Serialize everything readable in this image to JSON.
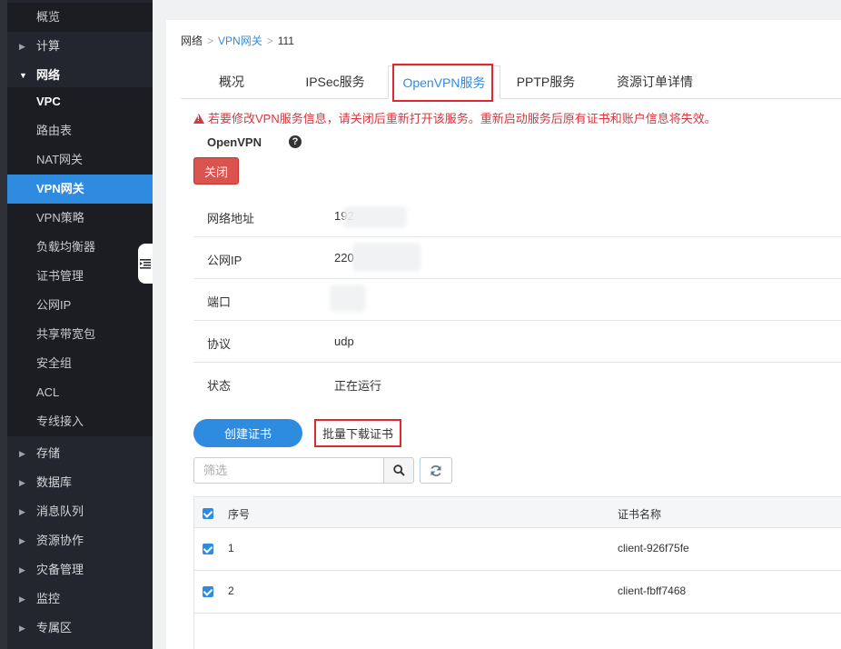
{
  "sidebar": {
    "items": [
      {
        "label": "概览",
        "type": "sub"
      },
      {
        "label": "计算",
        "type": "top"
      },
      {
        "label": "网络",
        "type": "open"
      },
      {
        "label": "VPC",
        "type": "vpc"
      },
      {
        "label": "路由表",
        "type": "sub"
      },
      {
        "label": "NAT网关",
        "type": "sub"
      },
      {
        "label": "VPN网关",
        "type": "active"
      },
      {
        "label": "VPN策略",
        "type": "sub"
      },
      {
        "label": "负载均衡器",
        "type": "sub"
      },
      {
        "label": "证书管理",
        "type": "sub"
      },
      {
        "label": "公网IP",
        "type": "sub"
      },
      {
        "label": "共享带宽包",
        "type": "sub"
      },
      {
        "label": "安全组",
        "type": "sub"
      },
      {
        "label": "ACL",
        "type": "sub"
      },
      {
        "label": "专线接入",
        "type": "sub"
      },
      {
        "label": "存储",
        "type": "top"
      },
      {
        "label": "数据库",
        "type": "top"
      },
      {
        "label": "消息队列",
        "type": "top"
      },
      {
        "label": "资源协作",
        "type": "top"
      },
      {
        "label": "灾备管理",
        "type": "top"
      },
      {
        "label": "监控",
        "type": "top"
      },
      {
        "label": "专属区",
        "type": "top"
      }
    ],
    "collapse_icon": "menu-collapse-icon"
  },
  "breadcrumb": {
    "root": "网络",
    "parent": "VPN网关",
    "current": "111",
    "separator": ">"
  },
  "tabs": [
    {
      "label": "概况"
    },
    {
      "label": "IPSec服务"
    },
    {
      "label": "OpenVPN服务"
    },
    {
      "label": "PPTP服务"
    },
    {
      "label": "资源订单详情"
    }
  ],
  "warning": "若要修改VPN服务信息，请关闭后重新打开该服务。重新启动服务后原有证书和账户信息将失效。",
  "service": {
    "title": "OpenVPN",
    "help": "?",
    "close_label": "关闭"
  },
  "info": [
    {
      "key": "网络地址",
      "value": "192"
    },
    {
      "key": "公网IP",
      "value": "220"
    },
    {
      "key": "端口",
      "value": ""
    },
    {
      "key": "协议",
      "value": "udp"
    },
    {
      "key": "状态",
      "value": "正在运行"
    }
  ],
  "actions": {
    "create_label": "创建证书",
    "batch_label": "批量下载证书"
  },
  "filter": {
    "placeholder": "筛选"
  },
  "table": {
    "columns": [
      "序号",
      "证书名称"
    ],
    "rows": [
      {
        "no": "1",
        "name": "client-926f75fe"
      },
      {
        "no": "2",
        "name": "client-fbff7468"
      }
    ]
  },
  "colors": {
    "accent": "#2f8be0",
    "danger": "#d9534f",
    "highlight": "#e0282e"
  }
}
